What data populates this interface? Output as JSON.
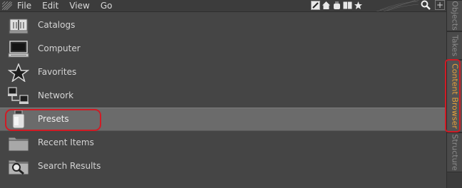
{
  "menubar": {
    "items": [
      "File",
      "Edit",
      "View",
      "Go"
    ]
  },
  "toolbar": {
    "icons": [
      "edit-icon",
      "home-icon",
      "preset-icon",
      "book-icon",
      "star-icon",
      "search-icon",
      "add-icon"
    ]
  },
  "list": {
    "items": [
      {
        "label": "Catalogs",
        "icon": "catalog-book-icon",
        "selected": false
      },
      {
        "label": "Computer",
        "icon": "computer-icon",
        "selected": false
      },
      {
        "label": "Favorites",
        "icon": "star-icon",
        "selected": false
      },
      {
        "label": "Network",
        "icon": "network-icon",
        "selected": false
      },
      {
        "label": "Presets",
        "icon": "presets-jar-icon",
        "selected": true
      },
      {
        "label": "Recent Items",
        "icon": "folder-icon",
        "selected": false
      },
      {
        "label": "Search Results",
        "icon": "magnifier-icon",
        "selected": false
      }
    ]
  },
  "side_tabs": [
    {
      "label": "Objects",
      "active": false
    },
    {
      "label": "Takes",
      "active": false
    },
    {
      "label": "Content Browser",
      "active": true
    },
    {
      "label": "Structure",
      "active": false
    }
  ],
  "colors": {
    "background": "#454545",
    "selected_row": "#6b6b6b",
    "active_tab_text": "#e6a23c",
    "highlight": "#d01b25"
  }
}
